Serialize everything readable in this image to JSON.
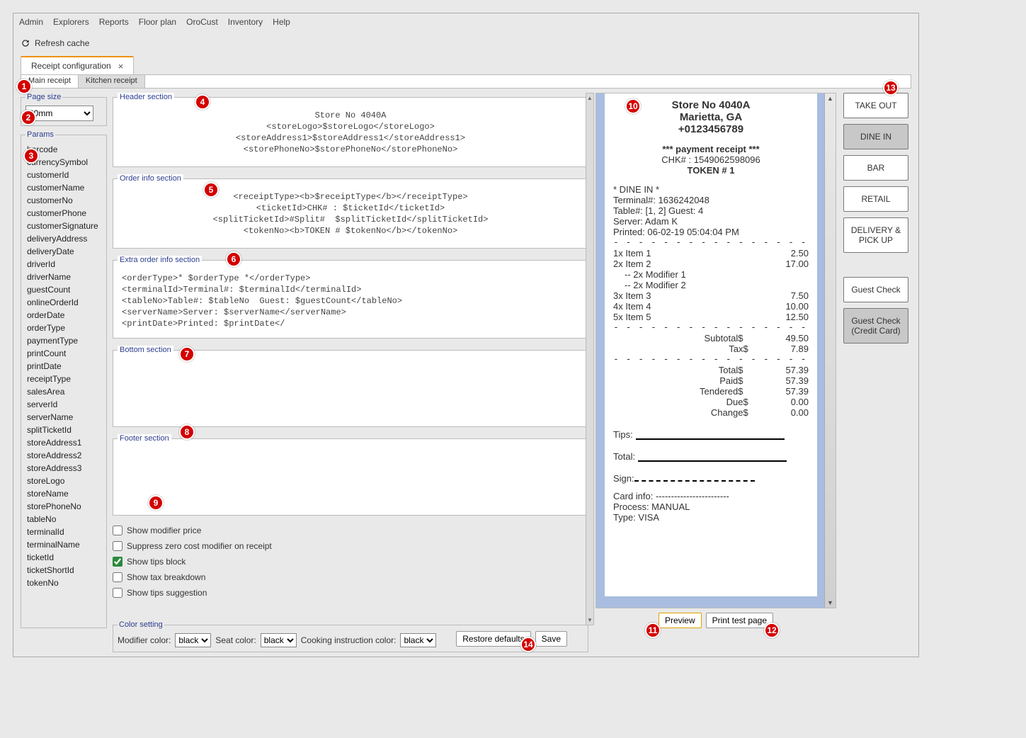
{
  "menu": {
    "items": [
      "Admin",
      "Explorers",
      "Reports",
      "Floor plan",
      "OroCust",
      "Inventory",
      "Help"
    ]
  },
  "toolbar": {
    "refresh": "Refresh cache"
  },
  "tab": {
    "label": "Receipt configuration"
  },
  "subtabs": {
    "main": "Main receipt",
    "kitchen": "Kitchen receipt"
  },
  "page_size": {
    "legend": "Page size",
    "value": "80mm"
  },
  "params": {
    "legend": "Params",
    "items": [
      "barcode",
      "currencySymbol",
      "customerId",
      "customerName",
      "customerNo",
      "customerPhone",
      "customerSignature",
      "deliveryAddress",
      "deliveryDate",
      "driverId",
      "driverName",
      "guestCount",
      "onlineOrderId",
      "orderDate",
      "orderType",
      "paymentType",
      "printCount",
      "printDate",
      "receiptType",
      "salesArea",
      "serverId",
      "serverName",
      "splitTicketId",
      "storeAddress1",
      "storeAddress2",
      "storeAddress3",
      "storeLogo",
      "storeName",
      "storePhoneNo",
      "tableNo",
      "terminalId",
      "terminalName",
      "ticketId",
      "ticketShortId",
      "tokenNo"
    ]
  },
  "sections": {
    "header": {
      "legend": "Header section",
      "code": "Store No 4040A\n<storeLogo>$storeLogo</storeLogo>\n<storeAddress1>$storeAddress1</storeAddress1>\n<storePhoneNo>$storePhoneNo</storePhoneNo>"
    },
    "order": {
      "legend": "Order info section",
      "code": "<receiptType><b>$receiptType</b></receiptType>\n<ticketId>CHK# : $ticketId</ticketId>\n<splitTicketId>#Split#  $splitTicketId</splitTicketId>\n<tokenNo><b>TOKEN # $tokenNo</b></tokenNo>"
    },
    "extra": {
      "legend": "Extra order info section",
      "code": "<orderType>* $orderType *</orderType>\n<terminalId>Terminal#: $terminalId</terminalId>\n<tableNo>Table#: $tableNo  Guest: $guestCount</tableNo>\n<serverName>Server: $serverName</serverName>\n<printDate>Printed: $printDate</"
    },
    "bottom": {
      "legend": "Bottom section",
      "code": ""
    },
    "footer": {
      "legend": "Footer section",
      "code": ""
    }
  },
  "options": {
    "show_modifier_price": "Show modifier price",
    "suppress_zero": "Suppress zero cost modifier on receipt",
    "show_tips_block": "Show tips block",
    "show_tax_breakdown": "Show tax breakdown",
    "show_tips_suggestion": "Show tips suggestion"
  },
  "colors": {
    "legend": "Color setting",
    "modifier_label": "Modifier color:",
    "seat_label": "Seat color:",
    "cooking_label": "Cooking instruction color:",
    "value": "black"
  },
  "buttons": {
    "restore": "Restore defaults",
    "save": "Save",
    "preview": "Preview",
    "print_test": "Print test page"
  },
  "preview": {
    "store": "Store No 4040A",
    "city": "Marietta, GA",
    "phone": "+0123456789",
    "receipt_type": "*** payment receipt ***",
    "chk": "CHK# : 1549062598096",
    "token": "TOKEN # 1",
    "order_type": "* DINE IN *",
    "terminal": "Terminal#: 1636242048",
    "table": "Table#: [1, 2] Guest: 4",
    "server": "Server: Adam K",
    "printed": "Printed: 06-02-19 05:04:04 PM",
    "items": [
      {
        "q": "1x",
        "n": "Item 1",
        "p": "2.50"
      },
      {
        "q": "2x",
        "n": "Item 2",
        "p": "17.00"
      }
    ],
    "mods": [
      "-- 2x Modifier 1",
      "-- 2x Modifier 2"
    ],
    "items2": [
      {
        "q": "3x",
        "n": "Item 3",
        "p": "7.50"
      },
      {
        "q": "4x",
        "n": "Item 4",
        "p": "10.00"
      },
      {
        "q": "5x",
        "n": "Item 5",
        "p": "12.50"
      }
    ],
    "subtotal_l": "Subtotal$",
    "subtotal_v": "49.50",
    "tax_l": "Tax$",
    "tax_v": "7.89",
    "total_l": "Total$",
    "total_v": "57.39",
    "paid_l": "Paid$",
    "paid_v": "57.39",
    "tendered_l": "Tendered$",
    "tendered_v": "57.39",
    "due_l": "Due$",
    "due_v": "0.00",
    "change_l": "Change$",
    "change_v": "0.00",
    "tips": "Tips:",
    "total": "Total:",
    "sign": "Sign:",
    "card": "Card info: ------------------------",
    "process": "Process: MANUAL",
    "type": "Type: VISA"
  },
  "right": {
    "take_out": "TAKE OUT",
    "dine_in": "DINE IN",
    "bar": "BAR",
    "retail": "RETAIL",
    "delivery": "DELIVERY & PICK UP",
    "guest_check": "Guest Check",
    "guest_check_cc": "Guest Check (Credit Card)"
  },
  "badges": [
    "1",
    "2",
    "3",
    "4",
    "5",
    "6",
    "7",
    "8",
    "9",
    "10",
    "11",
    "12",
    "13",
    "14"
  ]
}
